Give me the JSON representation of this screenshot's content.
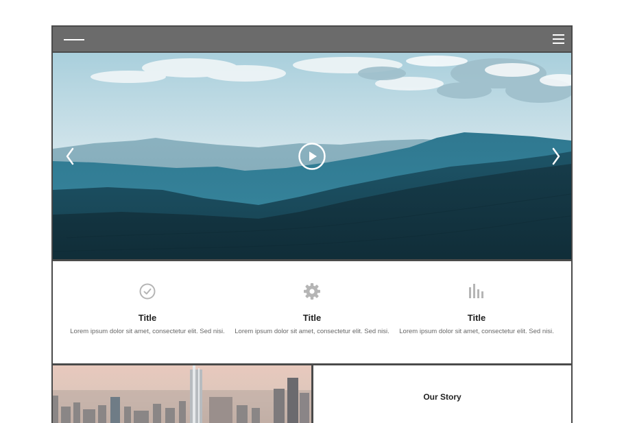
{
  "header": {
    "logo": "logo-line",
    "menu_icon": "hamburger-icon"
  },
  "hero": {
    "prev_icon": "chevron-left-icon",
    "next_icon": "chevron-right-icon",
    "play_icon": "play-circle-icon"
  },
  "features": [
    {
      "icon": "check-circle-icon",
      "title": "Title",
      "text": "Lorem ipsum dolor sit amet, consectetur elit. Sed nisi."
    },
    {
      "icon": "gear-icon",
      "title": "Title",
      "text": "Lorem ipsum dolor sit amet, consectetur elit. Sed nisi."
    },
    {
      "icon": "bar-chart-icon",
      "title": "Title",
      "text": "Lorem ipsum dolor sit amet, consectetur elit. Sed nisi."
    }
  ],
  "story": {
    "title": "Our Story"
  },
  "colors": {
    "topbar": "#6b6b6b",
    "border": "#4a4a4a",
    "icon_gray": "#b5b5b5",
    "title_text": "#222222",
    "body_text": "#666666"
  }
}
